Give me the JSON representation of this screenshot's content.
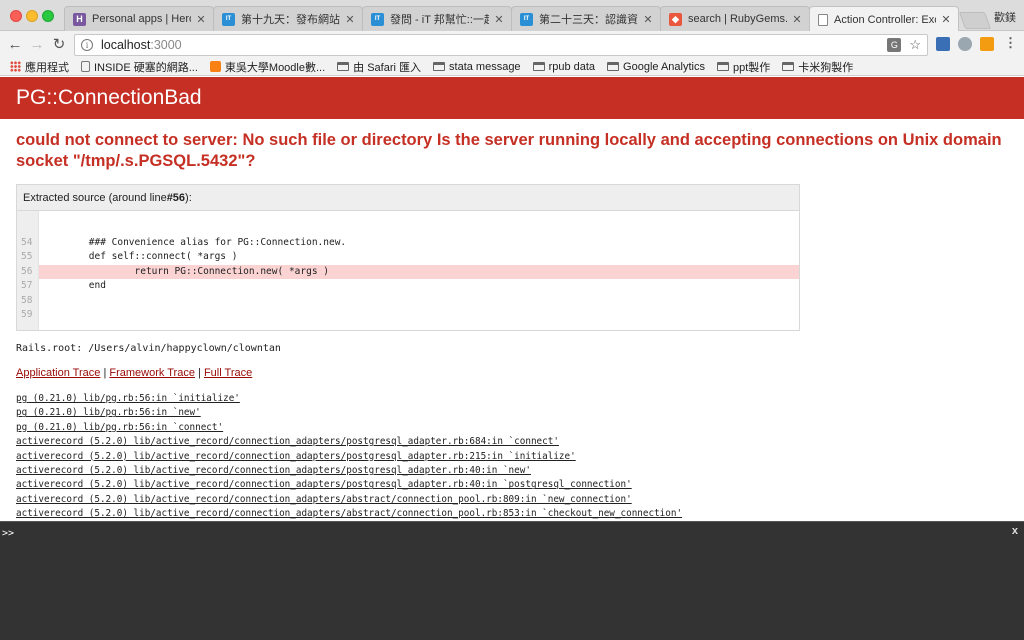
{
  "browser": {
    "tabs": [
      {
        "title": "Personal apps | Heroku",
        "favicon": "H",
        "color": "#79589f"
      },
      {
        "title": "第十九天：發布網站到 Heroku",
        "favicon": "IT",
        "color": "#2a8fd5"
      },
      {
        "title": "發問 - iT 邦幫忙::一起幫忙解決難題",
        "favicon": "IT",
        "color": "#2a8fd5"
      },
      {
        "title": "第二十三天：認識資料庫",
        "favicon": "IT",
        "color": "#2a8fd5"
      },
      {
        "title": "search | RubyGems.org",
        "favicon": "◆",
        "color": "#e9573f"
      },
      {
        "title": "Action Controller: Exception caught",
        "favicon": "▯",
        "color": "#ffffff"
      }
    ],
    "profile_name": "歡鎂",
    "address": {
      "host": "localhost",
      "port": ":3000"
    },
    "bookmarks": [
      {
        "label": "應用程式",
        "icon": "apps-grid-icon"
      },
      {
        "label": "INSIDE 硬塞的網路...",
        "icon": "document-icon"
      },
      {
        "label": "東吳大學Moodle數...",
        "icon": "moodle-icon"
      },
      {
        "label": "由 Safari 匯入",
        "icon": "folder-icon"
      },
      {
        "label": "stata message",
        "icon": "folder-icon"
      },
      {
        "label": "rpub data",
        "icon": "folder-icon"
      },
      {
        "label": "Google Analytics",
        "icon": "folder-icon"
      },
      {
        "label": "ppt製作",
        "icon": "folder-icon"
      },
      {
        "label": "卡米狗製作",
        "icon": "folder-icon"
      }
    ]
  },
  "page": {
    "title": "PG::ConnectionBad",
    "error_message": "could not connect to server: No such file or directory Is the server running locally and accepting connections on Unix domain socket \"/tmp/.s.PGSQL.5432\"?",
    "source": {
      "heading_prefix": "Extracted source (around line ",
      "heading_line": "#56",
      "heading_suffix": "):",
      "lines": [
        {
          "no": "54",
          "code": "        ### Convenience alias for PG::Connection.new.",
          "highlight": false
        },
        {
          "no": "55",
          "code": "        def self::connect( *args )",
          "highlight": false
        },
        {
          "no": "56",
          "code": "                return PG::Connection.new( *args )",
          "highlight": true
        },
        {
          "no": "57",
          "code": "        end",
          "highlight": false
        },
        {
          "no": "58",
          "code": "",
          "highlight": false
        },
        {
          "no": "59",
          "code": "",
          "highlight": false
        }
      ]
    },
    "rails_root": "Rails.root: /Users/alvin/happyclown/clowntan",
    "trace_links": {
      "application": "Application Trace",
      "framework": "Framework Trace",
      "full": "Full Trace",
      "separator": "|"
    },
    "trace": [
      "pg (0.21.0) lib/pg.rb:56:in `initialize'",
      "pg (0.21.0) lib/pg.rb:56:in `new'",
      "pg (0.21.0) lib/pg.rb:56:in `connect'",
      "activerecord (5.2.0) lib/active_record/connection_adapters/postgresql_adapter.rb:684:in `connect'",
      "activerecord (5.2.0) lib/active_record/connection_adapters/postgresql_adapter.rb:215:in `initialize'",
      "activerecord (5.2.0) lib/active_record/connection_adapters/postgresql_adapter.rb:40:in `new'",
      "activerecord (5.2.0) lib/active_record/connection_adapters/postgresql_adapter.rb:40:in `postgresql_connection'",
      "activerecord (5.2.0) lib/active_record/connection_adapters/abstract/connection_pool.rb:809:in `new_connection'",
      "activerecord (5.2.0) lib/active_record/connection_adapters/abstract/connection_pool.rb:853:in `checkout_new_connection'"
    ]
  },
  "console": {
    "prompt": ">>",
    "close": "x"
  },
  "colors": {
    "header_red": "#c52f24",
    "link_red": "#980905",
    "highlight": "#fbd3d3",
    "console_bg": "#333333"
  }
}
